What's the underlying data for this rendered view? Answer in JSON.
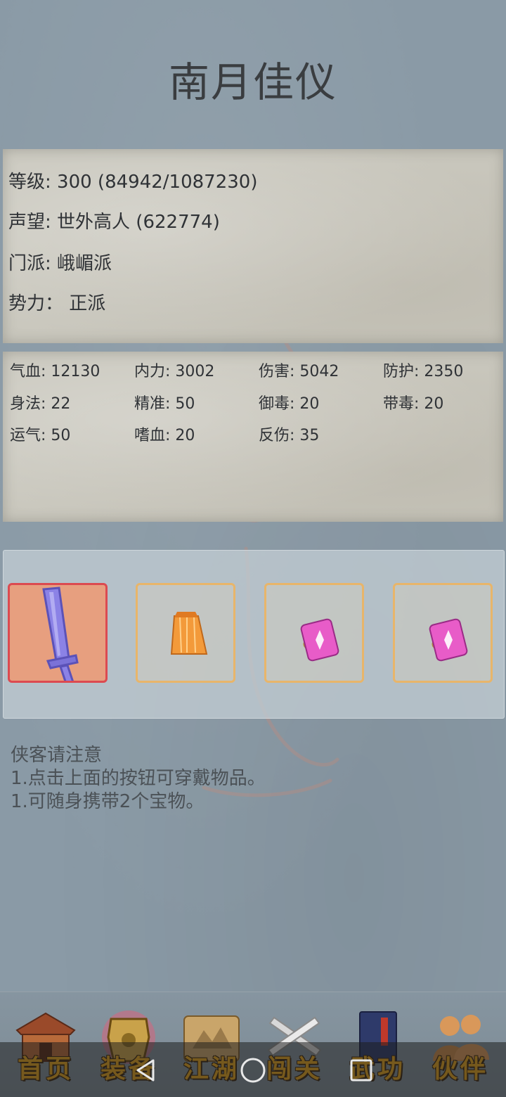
{
  "header": {
    "title": "南月佳仪"
  },
  "info": [
    {
      "label": "等级:",
      "value": "300 (84942/1087230)"
    },
    {
      "label": "声望:",
      "value": "世外高人 (622774)"
    },
    {
      "label": "门派:",
      "value": "峨嵋派"
    },
    {
      "label": "势力：",
      "value": "正派"
    }
  ],
  "stats": [
    {
      "label": "气血:",
      "value": "12130"
    },
    {
      "label": "内力:",
      "value": "3002"
    },
    {
      "label": "伤害:",
      "value": "5042"
    },
    {
      "label": "防护:",
      "value": "2350"
    },
    {
      "label": "身法:",
      "value": "22"
    },
    {
      "label": "精准:",
      "value": "50"
    },
    {
      "label": "御毒:",
      "value": "20"
    },
    {
      "label": "带毒:",
      "value": "20"
    },
    {
      "label": "运气:",
      "value": "50"
    },
    {
      "label": "嗜血:",
      "value": "20"
    },
    {
      "label": "反伤:",
      "value": "35"
    }
  ],
  "equipment": [
    {
      "slot": "weapon",
      "icon": "sword-icon",
      "selected": true
    },
    {
      "slot": "armor",
      "icon": "orange-robe-icon",
      "selected": false
    },
    {
      "slot": "treasure-1",
      "icon": "pink-gem-card-icon",
      "selected": false
    },
    {
      "slot": "treasure-2",
      "icon": "pink-gem-card-icon",
      "selected": false
    }
  ],
  "notice": {
    "title": "侠客请注意",
    "lines": [
      "1.点击上面的按钮可穿戴物品。",
      "1.可随身携带2个宝物。"
    ]
  },
  "nav": [
    {
      "label": "首页",
      "icon": "house-icon"
    },
    {
      "label": "装备",
      "icon": "armor-icon"
    },
    {
      "label": "江湖",
      "icon": "scroll-map-icon"
    },
    {
      "label": "闯关",
      "icon": "crossed-swords-icon"
    },
    {
      "label": "武功",
      "icon": "book-icon"
    },
    {
      "label": "伙伴",
      "icon": "partners-icon"
    }
  ],
  "system_nav": [
    "back-icon",
    "home-circle-icon",
    "recents-square-icon"
  ],
  "colors": {
    "background": "#8a9aa6",
    "paper": "#c9c7bd",
    "slot_border": "#e8b56a",
    "slot_selected_border": "#dc4a50",
    "nav_label": "#e2a21e"
  }
}
